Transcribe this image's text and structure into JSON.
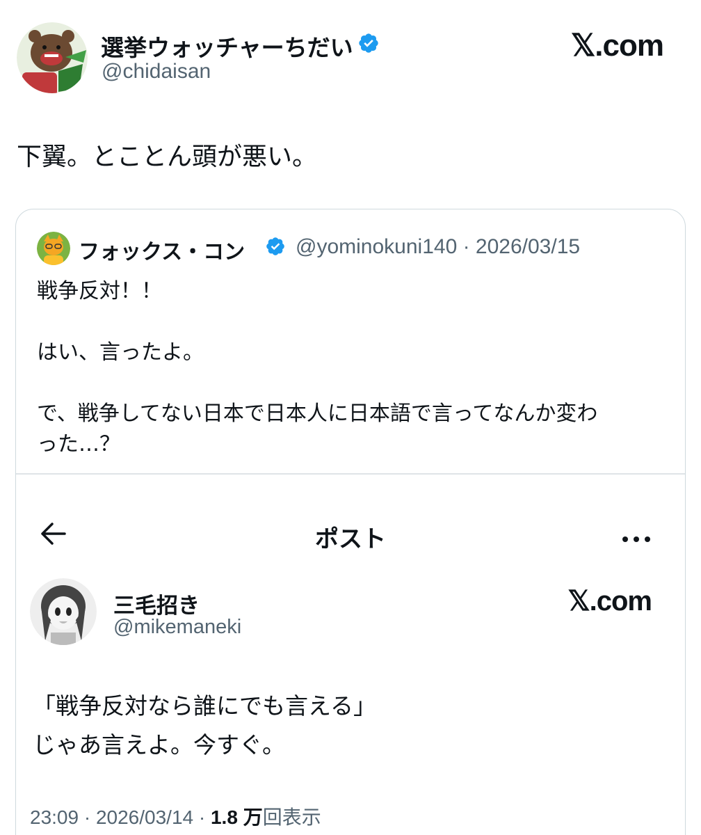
{
  "header": {
    "display_name": "選挙ウォッチャーちだい",
    "handle": "@chidaisan",
    "brand": "𝕏.com",
    "verified_color": "#1d9bf0"
  },
  "tweet": {
    "text": "下翼。とことん頭が悪い。"
  },
  "quote": {
    "display_name": "フォックス・コン",
    "handle_and_date": "@yominokuni140 · 2026/03/15",
    "lines": [
      "戦争反対！！",
      "",
      "はい、言ったよ。",
      "",
      "で、戦争してない日本で日本人に日本語で言ってなんか変わ",
      "った…？"
    ]
  },
  "screenshot": {
    "title": "ポスト",
    "display_name": "三毛招き",
    "handle": "@mikemaneki",
    "brand": "𝕏.com",
    "lines": [
      "「戦争反対なら誰にでも言える」",
      "じゃあ言えよ。今すぐ。"
    ],
    "meta_prefix": "23:09 · 2026/03/14 · ",
    "views_count": "1.8 万",
    "views_label": "回表示"
  },
  "colors": {
    "text": "#0f1419",
    "secondary": "#536471",
    "border": "#cfd9de",
    "verified": "#1d9bf0"
  }
}
